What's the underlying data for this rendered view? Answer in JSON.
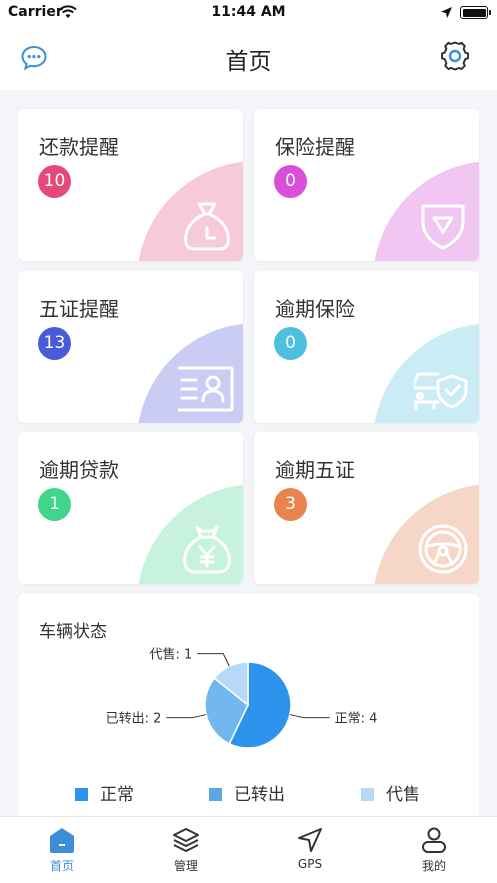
{
  "status_bar": {
    "carrier": "Carrier",
    "time": "11:44 AM"
  },
  "header": {
    "title": "首页"
  },
  "cards": [
    {
      "label": "还款提醒",
      "count": "10",
      "badge_color": "#e5497a",
      "blob_color": "#f6cad7",
      "icon": "money-bag-icon"
    },
    {
      "label": "保险提醒",
      "count": "0",
      "badge_color": "#d84fd8",
      "blob_color": "#f1c6f2",
      "icon": "shield-icon"
    },
    {
      "label": "五证提醒",
      "count": "13",
      "badge_color": "#4a5bd8",
      "blob_color": "#cbccf4",
      "icon": "id-card-icon"
    },
    {
      "label": "逾期保险",
      "count": "0",
      "badge_color": "#4ec0df",
      "blob_color": "#c9ecf5",
      "icon": "car-shield-icon"
    },
    {
      "label": "逾期贷款",
      "count": "1",
      "badge_color": "#3fd58b",
      "blob_color": "#c7f2dd",
      "icon": "yen-bag-icon"
    },
    {
      "label": "逾期五证",
      "count": "3",
      "badge_color": "#e8844d",
      "blob_color": "#f6d7c7",
      "icon": "steering-wheel-icon"
    }
  ],
  "vehicle_status": {
    "title": "车辆状态",
    "labels": [
      "正常: 4",
      "已转出: 2",
      "代售: 1"
    ]
  },
  "chart_data": {
    "type": "pie",
    "title": "车辆状态",
    "categories": [
      "正常",
      "已转出",
      "代售"
    ],
    "values": [
      4,
      2,
      1
    ],
    "colors": [
      "#2c93ec",
      "#72b8f0",
      "#b5d9f7"
    ],
    "legend_colors": [
      "#2c93ec",
      "#5aa8e0",
      "#b5d9f7"
    ],
    "legend": "bottom"
  },
  "tabs": [
    {
      "label": "首页",
      "icon": "home-icon",
      "active": true
    },
    {
      "label": "管理",
      "icon": "layers-icon",
      "active": false
    },
    {
      "label": "GPS",
      "icon": "navigation-arrow-icon",
      "active": false
    },
    {
      "label": "我的",
      "icon": "user-icon",
      "active": false
    }
  ]
}
